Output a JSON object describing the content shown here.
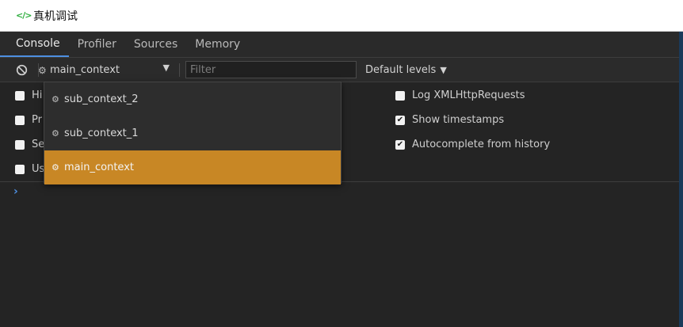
{
  "window": {
    "icon": "code-icon",
    "title": "真机调试"
  },
  "tabs": [
    {
      "label": "Console",
      "active": true
    },
    {
      "label": "Profiler",
      "active": false
    },
    {
      "label": "Sources",
      "active": false
    },
    {
      "label": "Memory",
      "active": false
    }
  ],
  "toolbar": {
    "clear_icon": "block-icon",
    "context_icon": "gear-icon",
    "context_selected": "main_context",
    "filter_value": "",
    "filter_placeholder": "Filter",
    "levels_label": "Default levels"
  },
  "settings": {
    "left": [
      {
        "label": "Hi",
        "checked": false
      },
      {
        "label": "Pr",
        "checked": false
      },
      {
        "label": "Se",
        "checked": false
      },
      {
        "label": "Us",
        "checked": false
      }
    ],
    "right": [
      {
        "label": "Log XMLHttpRequests",
        "checked": false
      },
      {
        "label": "Show timestamps",
        "checked": true
      },
      {
        "label": "Autocomplete from history",
        "checked": true
      }
    ]
  },
  "context_dropdown": {
    "items": [
      {
        "label": "sub_context_2",
        "selected": false
      },
      {
        "label": "sub_context_1",
        "selected": false
      },
      {
        "label": "main_context",
        "selected": true
      }
    ]
  },
  "console": {
    "prompt": "›"
  },
  "colors": {
    "accent": "#4d8fe1",
    "selected_item": "#c88725",
    "panel_bg": "#242424",
    "title_icon": "#2fae3f"
  }
}
